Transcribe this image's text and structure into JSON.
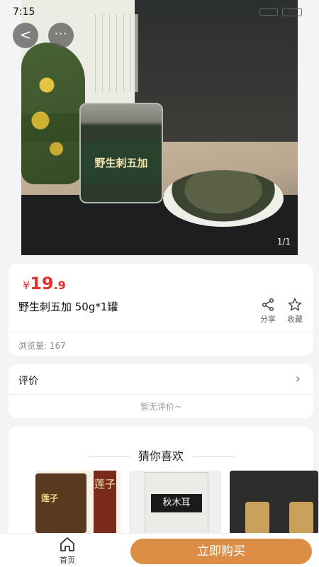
{
  "status_bar": {
    "time": "7:15",
    "battery": "75"
  },
  "header": {
    "back_icon": "<",
    "more_icon": "···"
  },
  "gallery": {
    "pager": "1/1",
    "jar_label": "野生刺五加"
  },
  "product": {
    "currency": "¥",
    "price_int": "19",
    "price_dec": ".9",
    "title": "野生刺五加 50g*1罐",
    "share_label": "分享",
    "favorite_label": "收藏",
    "views": "浏览量: 167"
  },
  "reviews": {
    "title": "评价",
    "empty_text": "暂无评价~"
  },
  "recommend": {
    "title": "猜你喜欢",
    "items": [
      {
        "name": "莲子"
      },
      {
        "name": "秋木耳"
      },
      {
        "name": ""
      }
    ]
  },
  "bottom_bar": {
    "home_label": "首页",
    "buy_label": "立即购买"
  },
  "colors": {
    "price": "#e5302b",
    "buy_button": "#dc8e47"
  }
}
